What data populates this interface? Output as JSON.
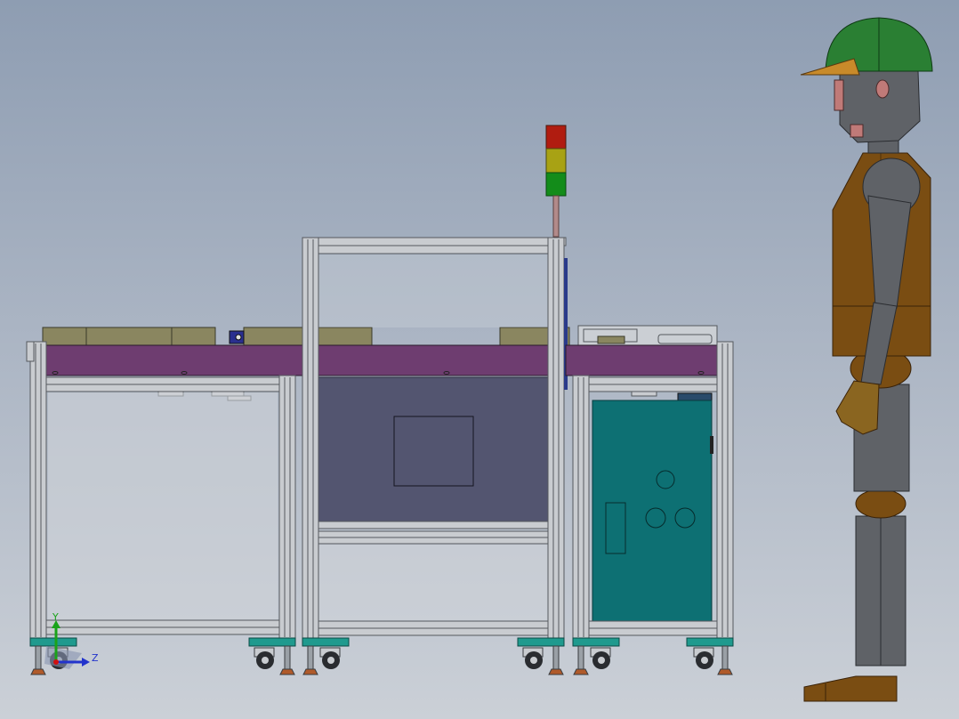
{
  "view": {
    "type": "cad-assembly-front-view",
    "background_top": "#8e9db2",
    "background_bottom": "#cbd0d7"
  },
  "colors": {
    "aluminum_frame": "#c9ccd0",
    "aluminum_edge": "#55595e",
    "conveyor_belt": "#6e3d70",
    "tray": "#8a8660",
    "machine_panel": "#535570",
    "cabinet": "#0d7073",
    "feet": "#1f9a8e",
    "light_red": "#b01c10",
    "light_yellow": "#a8a214",
    "light_green": "#138c1a",
    "helmet": "#2a7f33",
    "vest": "#7a4d12",
    "mannequin_body": "#5f6267"
  },
  "triad": {
    "y_label": "Y",
    "z_label": "Z",
    "y_color": "#1aa31a",
    "z_color": "#2233cc",
    "origin_color": "#d01010"
  },
  "components": [
    "left-conveyor-frame",
    "center-frame",
    "right-cabinet-frame",
    "signal-tower",
    "human-mannequin"
  ]
}
